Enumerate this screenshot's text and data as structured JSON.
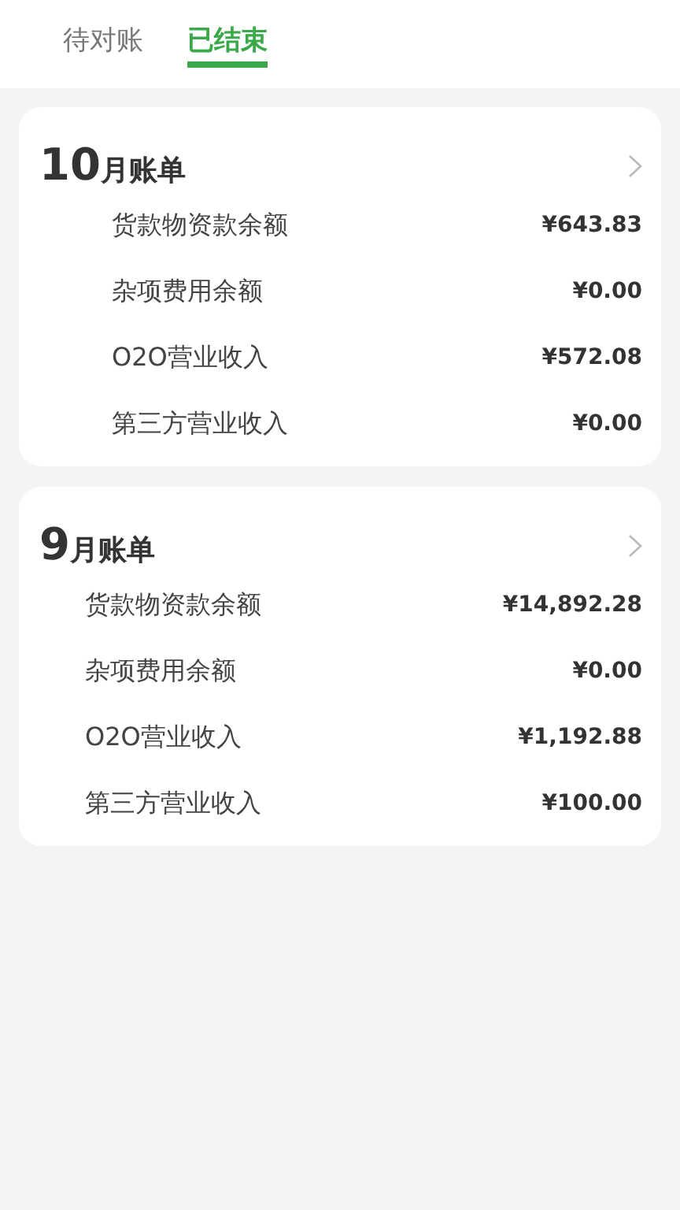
{
  "tabs": [
    {
      "label": "待对账",
      "selected": false
    },
    {
      "label": "已结束",
      "selected": true
    }
  ],
  "bills": [
    {
      "month": "10",
      "label": "月账单",
      "rows": [
        {
          "name": "货款物资款余额",
          "amount": "¥643.83"
        },
        {
          "name": "杂项费用余额",
          "amount": "¥0.00"
        },
        {
          "name": "O2O营业收入",
          "amount": "¥572.08"
        },
        {
          "name": "第三方营业收入",
          "amount": "¥0.00"
        }
      ]
    },
    {
      "month": "9",
      "label": "月账单",
      "rows": [
        {
          "name": "货款物资款余额",
          "amount": "¥14,892.28"
        },
        {
          "name": "杂项费用余额",
          "amount": "¥0.00"
        },
        {
          "name": "O2O营业收入",
          "amount": "¥1,192.88"
        },
        {
          "name": "第三方营业收入",
          "amount": "¥100.00"
        }
      ]
    }
  ]
}
